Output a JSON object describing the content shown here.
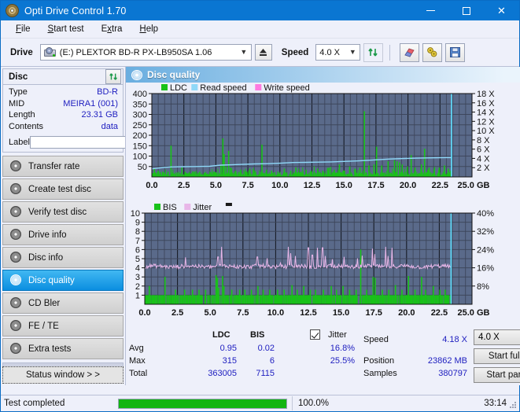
{
  "window": {
    "title": "Opti Drive Control 1.70",
    "icon": "disc-icon",
    "minimize": "minimize-icon",
    "maximize": "maximize-icon",
    "close": "close-icon"
  },
  "menu": {
    "items": [
      {
        "label": "File",
        "accel": "F"
      },
      {
        "label": "Start test",
        "accel": "S"
      },
      {
        "label": "Extra",
        "accel": "x"
      },
      {
        "label": "Help",
        "accel": "H"
      }
    ]
  },
  "toolbar": {
    "drive_label": "Drive",
    "drive_value": "(E:)  PLEXTOR BD-R  PX-LB950SA 1.06",
    "eject_icon": "eject-icon",
    "speed_label": "Speed",
    "speed_value": "4.0 X",
    "refresh_icon": "refresh-icon",
    "erase_icon": "eraser-icon",
    "tools_icon": "wrench-icon",
    "save_icon": "save-icon"
  },
  "disc_panel": {
    "title": "Disc",
    "refresh_icon": "refresh-icon",
    "rows": [
      {
        "key": "Type",
        "value": "BD-R"
      },
      {
        "key": "MID",
        "value": "MEIRA1 (001)"
      },
      {
        "key": "Length",
        "value": "23.31 GB"
      },
      {
        "key": "Contents",
        "value": "data"
      }
    ],
    "label_key": "Label",
    "label_value": "",
    "label_placeholder": "",
    "label_button_icon": "disc-label-icon"
  },
  "nav": {
    "items": [
      {
        "label": "Transfer rate",
        "icon": "disc-transfer-icon",
        "selected": false
      },
      {
        "label": "Create test disc",
        "icon": "disc-create-icon",
        "selected": false
      },
      {
        "label": "Verify test disc",
        "icon": "disc-verify-icon",
        "selected": false
      },
      {
        "label": "Drive info",
        "icon": "disc-drive-icon",
        "selected": false
      },
      {
        "label": "Disc info",
        "icon": "disc-info-icon",
        "selected": false
      },
      {
        "label": "Disc quality",
        "icon": "disc-quality-icon",
        "selected": true
      },
      {
        "label": "CD Bler",
        "icon": "disc-bler-icon",
        "selected": false
      },
      {
        "label": "FE / TE",
        "icon": "disc-fete-icon",
        "selected": false
      },
      {
        "label": "Extra tests",
        "icon": "disc-extra-icon",
        "selected": false
      }
    ],
    "status_window": "Status window > >"
  },
  "main": {
    "header": "Disc quality",
    "header_icon": "disc-quality-icon"
  },
  "stats": {
    "col_ldc": "LDC",
    "col_bis": "BIS",
    "row_avg": "Avg",
    "row_max": "Max",
    "row_total": "Total",
    "ldc_avg": "0.95",
    "ldc_max": "315",
    "ldc_total": "363005",
    "bis_avg": "0.02",
    "bis_max": "6",
    "bis_total": "7115",
    "jitter_label": "Jitter",
    "jitter_checked": true,
    "jitter_avg": "16.8%",
    "jitter_max": "25.5%",
    "speed_key": "Speed",
    "speed_value": "4.18 X",
    "position_key": "Position",
    "position_value": "23862 MB",
    "samples_key": "Samples",
    "samples_value": "380797",
    "speed_select": "4.0 X",
    "start_full": "Start full",
    "start_part": "Start part"
  },
  "statusbar": {
    "message": "Test completed",
    "progress_pct": "100.0%",
    "progress_value": 100,
    "elapsed": "33:14"
  },
  "colors": {
    "title_bar": "#0a76d2",
    "accent": "#0b8ee0",
    "plot_bg": "#5a6a8a",
    "plot_grid": "#3c4459",
    "ldc_green": "#19c219",
    "bis_green": "#19c219",
    "read_speed": "#8fd8f8",
    "write_speed": "#ff7ae0",
    "jitter_pink": "#e8b6e8",
    "cursor_cyan": "#5fe0ff",
    "progress_green": "#12b512",
    "value_blue": "#2020c0"
  },
  "chart_data": [
    {
      "type": "line",
      "name": "ldc-chart",
      "title": "",
      "xlabel": "GB",
      "ylabel": "",
      "xlim": [
        0,
        25
      ],
      "xticks": [
        0.0,
        2.5,
        5.0,
        7.5,
        10.0,
        12.5,
        15.0,
        17.5,
        20.0,
        22.5,
        25.0
      ],
      "xticklabels": [
        "0.0",
        "2.5",
        "5.0",
        "7.5",
        "10.0",
        "12.5",
        "15.0",
        "17.5",
        "20.0",
        "22.5",
        "25.0 GB"
      ],
      "ylim": [
        0,
        400
      ],
      "yticks": [
        50,
        100,
        150,
        200,
        250,
        300,
        350,
        400
      ],
      "yticklabels": [
        "50",
        "100",
        "150",
        "200",
        "250",
        "300",
        "350",
        "400"
      ],
      "y2lim": [
        0,
        18
      ],
      "y2ticks": [
        2,
        4,
        6,
        8,
        10,
        12,
        14,
        16,
        18
      ],
      "y2ticklabels": [
        "2 X",
        "4 X",
        "6 X",
        "8 X",
        "10 X",
        "12 X",
        "14 X",
        "16 X",
        "18 X"
      ],
      "grid": true,
      "legend": [
        "LDC",
        "Read speed",
        "Write speed"
      ],
      "legend_position": "top-left",
      "series": [
        {
          "name": "LDC",
          "kind": "bar",
          "color": "#19c219",
          "peaks_x": [
            0.15,
            0.45,
            0.8,
            1.2,
            1.45,
            2.3,
            2.55,
            2.9,
            3.3,
            3.7,
            4.1,
            4.5,
            4.9,
            5.35,
            5.5,
            5.6,
            5.75,
            5.95,
            6.1,
            6.5,
            6.9,
            7.3,
            7.6,
            8.0,
            8.55,
            8.9,
            9.3,
            9.8,
            10.3,
            10.8,
            11.2,
            11.6,
            12.0,
            12.4,
            12.9,
            13.3,
            13.8,
            14.2,
            14.6,
            15.0,
            15.4,
            15.8,
            16.2,
            16.55,
            16.9,
            17.3,
            17.5,
            17.9,
            18.4,
            18.9,
            19.1,
            19.3,
            19.5,
            19.9,
            20.2,
            20.5,
            21.0,
            21.25,
            21.6,
            22.0,
            22.4,
            22.8,
            23.1,
            23.3
          ],
          "peaks_y": [
            40,
            30,
            25,
            25,
            150,
            45,
            25,
            20,
            25,
            25,
            20,
            25,
            20,
            60,
            185,
            110,
            50,
            125,
            45,
            30,
            35,
            25,
            40,
            30,
            155,
            35,
            30,
            25,
            40,
            30,
            45,
            25,
            35,
            30,
            40,
            30,
            45,
            35,
            60,
            30,
            50,
            40,
            45,
            315,
            55,
            60,
            145,
            55,
            75,
            80,
            75,
            70,
            60,
            50,
            105,
            45,
            60,
            135,
            45,
            40,
            45,
            55,
            40,
            30
          ]
        },
        {
          "name": "Read speed",
          "kind": "line",
          "color": "#8fd8f8",
          "axis": "right",
          "x": [
            0.0,
            0.5,
            1.0,
            1.5,
            2.5,
            3.5,
            4.5,
            5.4,
            6.0,
            7.0,
            8.0,
            9.0,
            10.0,
            11.0,
            12.0,
            13.0,
            14.0,
            15.0,
            16.0,
            17.0,
            17.6,
            18.5,
            19.5,
            20.5,
            21.2,
            22.0,
            23.0,
            23.4
          ],
          "y": [
            1.75,
            1.9,
            2.05,
            2.15,
            2.2,
            2.25,
            2.3,
            2.55,
            2.6,
            2.7,
            2.8,
            2.85,
            2.95,
            3.1,
            3.15,
            3.2,
            3.25,
            3.35,
            3.45,
            3.6,
            3.7,
            3.85,
            3.95,
            4.05,
            4.1,
            4.12,
            4.18,
            4.18
          ]
        },
        {
          "name": "Write speed",
          "kind": "line",
          "color": "#ff7ae0",
          "axis": "right",
          "x": [],
          "y": []
        }
      ],
      "cursor_x": 23.4
    },
    {
      "type": "line",
      "name": "bis-jitter-chart",
      "title": "",
      "xlabel": "GB",
      "ylabel": "",
      "xlim": [
        0,
        25
      ],
      "xticks": [
        0.0,
        2.5,
        5.0,
        7.5,
        10.0,
        12.5,
        15.0,
        17.5,
        20.0,
        22.5,
        25.0
      ],
      "xticklabels": [
        "0.0",
        "2.5",
        "5.0",
        "7.5",
        "10.0",
        "12.5",
        "15.0",
        "17.5",
        "20.0",
        "22.5",
        "25.0 GB"
      ],
      "ylim": [
        0,
        10
      ],
      "yticks": [
        1,
        2,
        3,
        4,
        5,
        6,
        7,
        8,
        9,
        10
      ],
      "yticklabels": [
        "1",
        "2",
        "3",
        "4",
        "5",
        "6",
        "7",
        "8",
        "9",
        "10"
      ],
      "y2lim": [
        0,
        40
      ],
      "y2ticks": [
        8,
        16,
        24,
        32,
        40
      ],
      "y2ticklabels": [
        "8%",
        "16%",
        "24%",
        "32%",
        "40%"
      ],
      "grid": true,
      "legend": [
        "BIS",
        "Jitter"
      ],
      "legend_position": "top-left",
      "series": [
        {
          "name": "BIS",
          "kind": "bar",
          "color": "#19c219",
          "baseline": 1,
          "peaks_x": [
            0.3,
            1.5,
            2.3,
            3.0,
            3.6,
            4.1,
            4.6,
            5.4,
            5.5,
            5.6,
            5.9,
            6.0,
            6.6,
            7.2,
            7.6,
            8.1,
            8.6,
            9.0,
            9.5,
            10.1,
            10.6,
            11.2,
            11.6,
            12.1,
            12.6,
            13.0,
            13.6,
            14.2,
            14.6,
            15.1,
            15.6,
            16.1,
            16.45,
            16.9,
            17.4,
            17.55,
            18.1,
            18.6,
            19.1,
            19.6,
            20.1,
            20.6,
            21.1,
            21.4,
            22.0,
            22.5,
            22.9
          ],
          "peaks_y": [
            2,
            3,
            1.6,
            1.6,
            1.6,
            1.6,
            1.6,
            3.2,
            2.9,
            1.8,
            3.1,
            2.0,
            1.6,
            1.6,
            1.6,
            1.6,
            2.0,
            1.6,
            1.6,
            1.6,
            1.6,
            2.1,
            1.6,
            2.0,
            1.6,
            1.6,
            1.6,
            2.0,
            1.6,
            2.0,
            1.6,
            1.6,
            6.0,
            1.6,
            3.0,
            2.9,
            1.6,
            1.6,
            2.1,
            1.6,
            3.1,
            1.6,
            3.0,
            1.6,
            2.0,
            1.6,
            1.6
          ]
        },
        {
          "name": "Jitter",
          "kind": "line",
          "color": "#e8b6e8",
          "axis": "right",
          "mean_pct": 16.8,
          "max_pct": 25.5,
          "baseline_y": 4.15,
          "noise": 0.22,
          "spikes_x": [
            5.6,
            5.9,
            7.6,
            8.6,
            11.0,
            11.2,
            11.5,
            12.5,
            12.8,
            13.2,
            13.6,
            13.8,
            15.2,
            17.4,
            17.6,
            18.4,
            18.6,
            18.9,
            21.4
          ],
          "spikes_y": [
            5.2,
            6.3,
            6.2,
            5.2,
            6.3,
            5.6,
            5.3,
            6.2,
            5.4,
            6.2,
            6.2,
            5.3,
            5.2,
            6.1,
            5.5,
            6.3,
            5.3,
            6.2,
            6.3
          ]
        }
      ],
      "cursor_x": 23.4
    }
  ]
}
